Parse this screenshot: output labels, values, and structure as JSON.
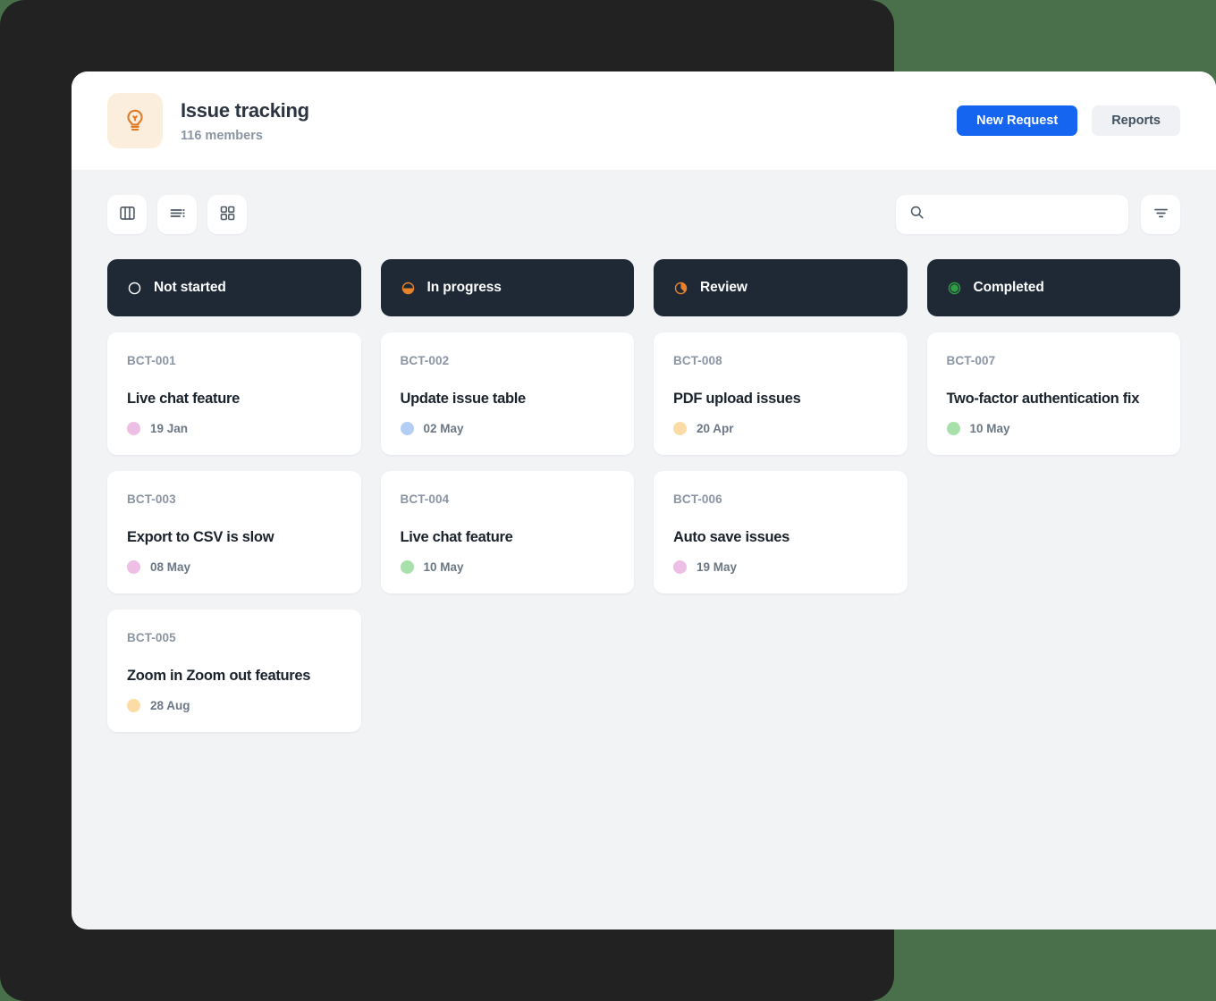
{
  "window": {
    "backdrop_color": "#222222",
    "page_background": "#49704a",
    "body_background": "#f1f3f5"
  },
  "header": {
    "brand_icon": "lightbulb-icon",
    "brand_icon_bg": "#fbeedd",
    "brand_icon_color": "#e07b2a",
    "title": "Issue tracking",
    "subtitle": "116 members",
    "primary_button": "New Request",
    "secondary_button": "Reports",
    "primary_color": "#1565f0"
  },
  "toolbar": {
    "views": [
      {
        "name": "board-view-icon",
        "label": "Board view"
      },
      {
        "name": "list-view-icon",
        "label": "List view"
      },
      {
        "name": "grid-view-icon",
        "label": "Grid view"
      }
    ],
    "search": {
      "value": "",
      "placeholder": ""
    },
    "filter_label": "Filter"
  },
  "board": {
    "columns": [
      {
        "id": "not-started",
        "label": "Not started",
        "status_icon": "circle-empty-icon",
        "status_color": "#ffffff",
        "cards": [
          {
            "id": "BCT-001",
            "title": "Live chat feature",
            "date": "19 Jan",
            "dot_color": "#edbfe4"
          },
          {
            "id": "BCT-003",
            "title": "Export to CSV is slow",
            "date": "08 May",
            "dot_color": "#edbfe4"
          },
          {
            "id": "BCT-005",
            "title": "Zoom in Zoom out features",
            "date": "28 Aug",
            "dot_color": "#fbdca6"
          }
        ]
      },
      {
        "id": "in-progress",
        "label": "In progress",
        "status_icon": "circle-half-filled-icon",
        "status_color": "#e8832b",
        "cards": [
          {
            "id": "BCT-002",
            "title": "Update issue table",
            "date": "02 May",
            "dot_color": "#b3cdf5"
          },
          {
            "id": "BCT-004",
            "title": "Live chat feature",
            "date": "10 May",
            "dot_color": "#a8e0ab"
          }
        ]
      },
      {
        "id": "review",
        "label": "Review",
        "status_icon": "circle-pie-filled-icon",
        "status_color": "#e8832b",
        "cards": [
          {
            "id": "BCT-008",
            "title": "PDF upload issues",
            "date": "20 Apr",
            "dot_color": "#fbdca6"
          },
          {
            "id": "BCT-006",
            "title": "Auto save issues",
            "date": "19 May",
            "dot_color": "#edbfe4"
          }
        ]
      },
      {
        "id": "completed",
        "label": "Completed",
        "status_icon": "circle-solid-icon",
        "status_color": "#2f9e44",
        "cards": [
          {
            "id": "BCT-007",
            "title": "Two-factor authentication fix",
            "date": "10 May",
            "dot_color": "#a8e0ab"
          }
        ]
      }
    ]
  }
}
